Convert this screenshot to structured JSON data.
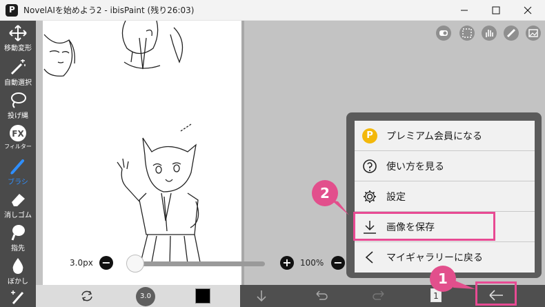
{
  "window": {
    "title": "NovelAIを始めよう2 - ibisPaint (残り26:03)",
    "controls": [
      "minimize-icon",
      "maximize-icon",
      "close-icon"
    ]
  },
  "tools": [
    {
      "label": "移動変形",
      "icon": "move-icon"
    },
    {
      "label": "自動選択",
      "icon": "magic-wand-icon"
    },
    {
      "label": "投げ縄",
      "icon": "lasso-icon"
    },
    {
      "label": "フィルター",
      "icon": "fx-icon"
    },
    {
      "label": "ブラシ",
      "icon": "brush-icon",
      "active": true
    },
    {
      "label": "消しゴム",
      "icon": "eraser-icon"
    },
    {
      "label": "指先",
      "icon": "smudge-icon"
    },
    {
      "label": "ぼかし",
      "icon": "blur-icon"
    }
  ],
  "slider": {
    "brush_size": "3.0px",
    "zoom": "100%",
    "minus": "−",
    "plus": "+"
  },
  "bottom_bar": {
    "brush_value": "3.0",
    "layer_count": "1"
  },
  "menu": {
    "items": [
      {
        "label": "プレミアム会員になる",
        "icon": "premium-icon",
        "icon_text": "P"
      },
      {
        "label": "使い方を見る",
        "icon": "help-icon"
      },
      {
        "label": "設定",
        "icon": "gear-icon"
      },
      {
        "label": "画像を保存",
        "icon": "download-icon"
      },
      {
        "label": "マイギャラリーに戻る",
        "icon": "chevron-left-icon"
      }
    ]
  },
  "annotations": {
    "step1": "1",
    "step2": "2",
    "highlight_color": "#e84a93"
  },
  "colors": {
    "accent": "#2f8fff",
    "menu_bg": "#5b5b5b",
    "premium": "#f3b80b"
  }
}
